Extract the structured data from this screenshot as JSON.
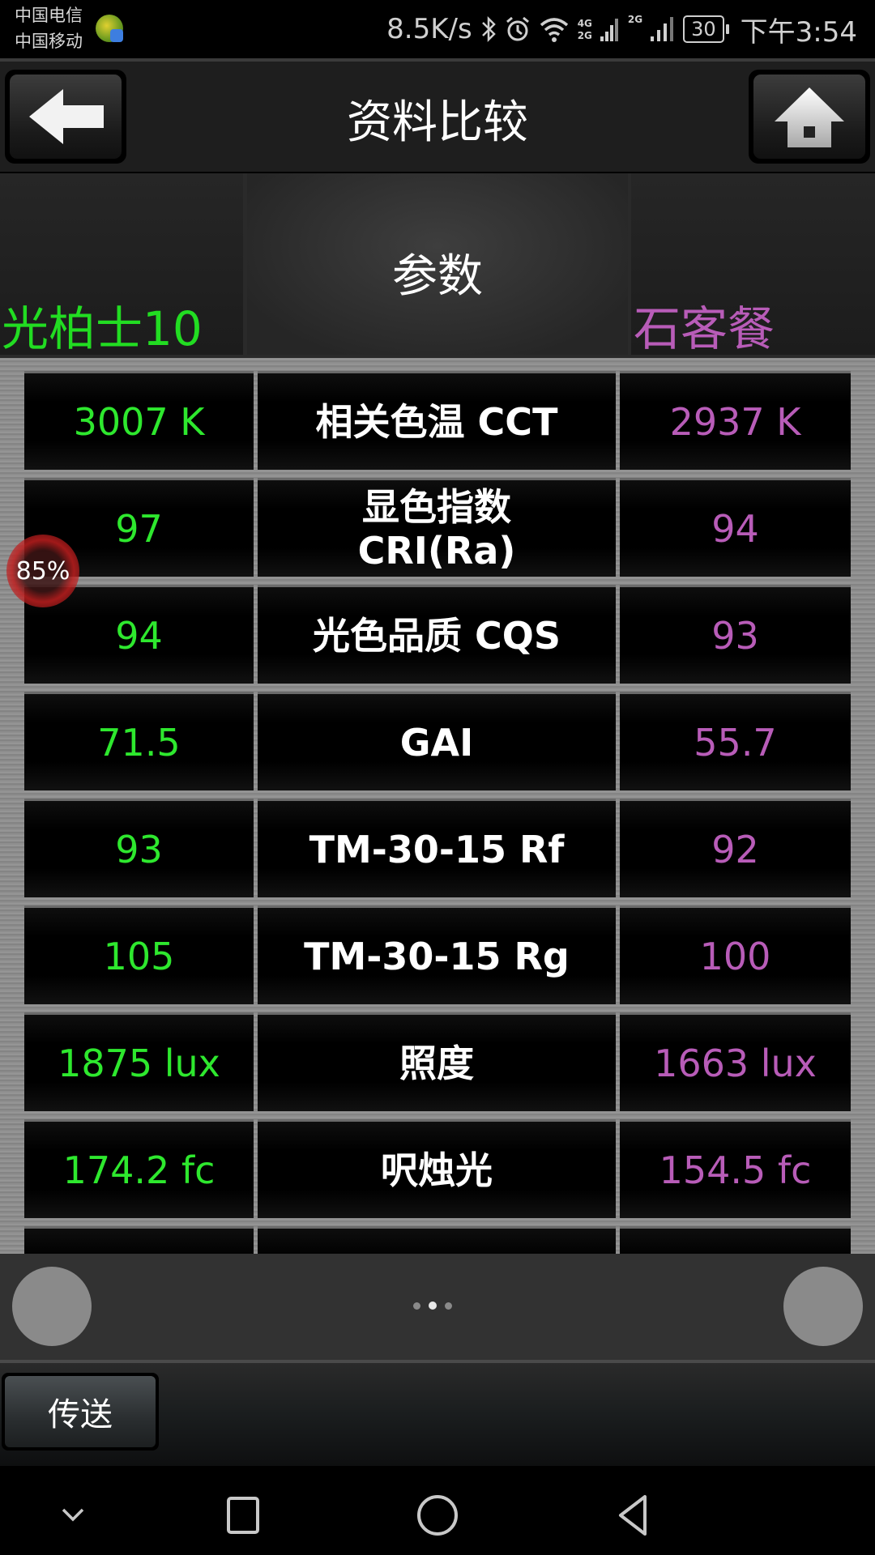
{
  "status_bar": {
    "carrier_1": "中国电信",
    "carrier_2": "中国移动",
    "net_speed": "8.5K/s",
    "net_type_1": "4G",
    "net_type_2": "2G",
    "net_type_3": "2G",
    "battery": "30",
    "time": "下午3:54",
    "icons": [
      "bluetooth-icon",
      "alarm-icon",
      "wifi-icon",
      "signal-icon",
      "signal-icon",
      "battery-icon"
    ]
  },
  "header": {
    "title": "资料比较",
    "back_icon": "arrow-left-icon",
    "home_icon": "home-icon"
  },
  "columns": {
    "device_a": "光柏士10",
    "parameter": "参数",
    "device_b": "石客餐"
  },
  "colors": {
    "device_a": "#2ee82e",
    "device_b": "#b85cb8"
  },
  "rows": [
    {
      "a": "3007 K",
      "param": "相关色温 CCT",
      "b": "2937 K"
    },
    {
      "a": "97",
      "param": "显色指数\nCRI(Ra)",
      "b": "94"
    },
    {
      "a": "94",
      "param": "光色品质 CQS",
      "b": "93"
    },
    {
      "a": "71.5",
      "param": "GAI",
      "b": "55.7"
    },
    {
      "a": "93",
      "param": "TM-30-15 Rf",
      "b": "92"
    },
    {
      "a": "105",
      "param": "TM-30-15 Rg",
      "b": "100"
    },
    {
      "a": "1875 lux",
      "param": "照度",
      "b": "1663 lux"
    },
    {
      "a": "174.2 fc",
      "param": "呎烛光",
      "b": "154.5 fc"
    },
    {
      "a": "",
      "param": "",
      "b": ""
    }
  ],
  "overlay": {
    "percent": "85%"
  },
  "pager": {
    "pages": 3,
    "current": 2
  },
  "actions": {
    "send_label": "传送"
  },
  "nav": {
    "items": [
      "chevron-down-icon",
      "recents-icon",
      "home-circle-icon",
      "back-triangle-icon"
    ]
  }
}
